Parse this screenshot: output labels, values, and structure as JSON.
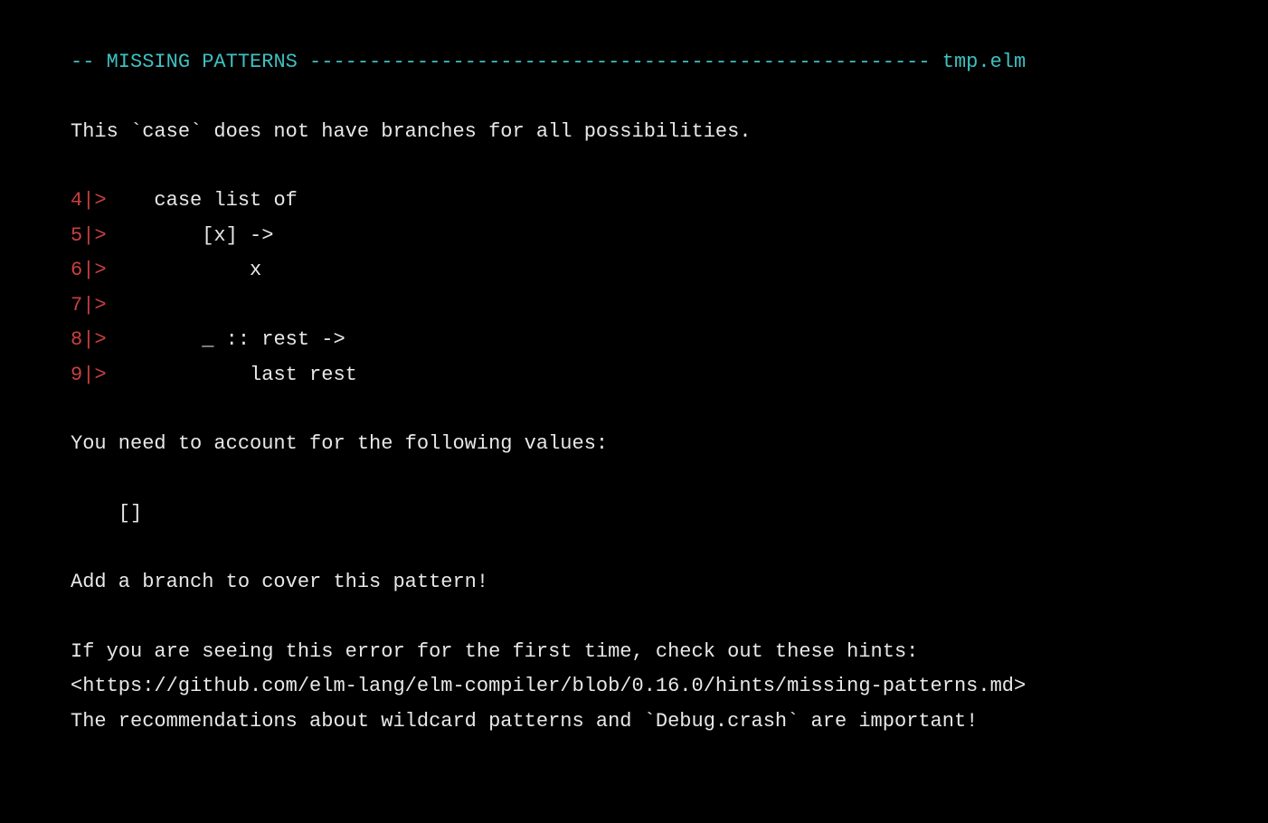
{
  "header": {
    "prefix": "-- ",
    "title": "MISSING PATTERNS",
    "dashes": " ---------------------------------------------------- ",
    "filename": "tmp.elm"
  },
  "intro": "This `case` does not have branches for all possibilities.",
  "code": {
    "lines": [
      {
        "gutter": "4|>",
        "content": "    case list of"
      },
      {
        "gutter": "5|>",
        "content": "        [x] ->"
      },
      {
        "gutter": "6|>",
        "content": "            x"
      },
      {
        "gutter": "7|>",
        "content": ""
      },
      {
        "gutter": "8|>",
        "content": "        _ :: rest ->"
      },
      {
        "gutter": "9|>",
        "content": "            last rest"
      }
    ]
  },
  "need_account": "You need to account for the following values:",
  "missing_pattern": "    []",
  "add_branch": "Add a branch to cover this pattern!",
  "hints_intro": "If you are seeing this error for the first time, check out these hints:",
  "hints_url": "<https://github.com/elm-lang/elm-compiler/blob/0.16.0/hints/missing-patterns.md>",
  "recommendations": "The recommendations about wildcard patterns and `Debug.crash` are important!"
}
